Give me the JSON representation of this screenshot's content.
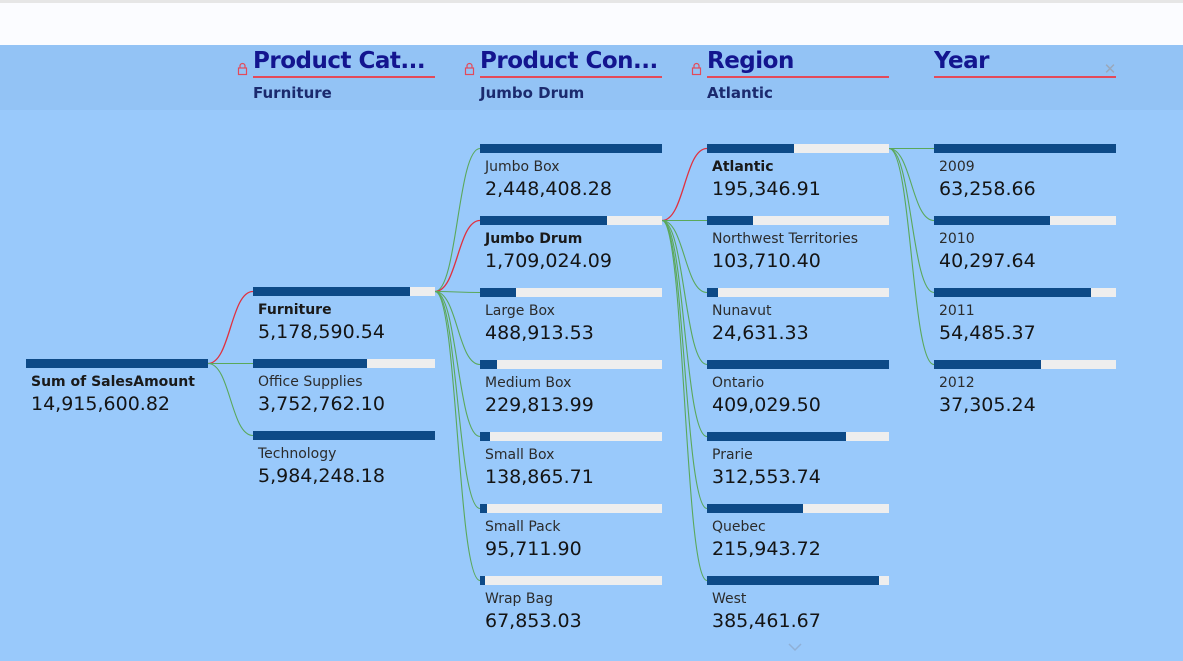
{
  "chart_data": {
    "type": "decomposition-tree",
    "root": {
      "label": "Sum of SalesAmount",
      "value": 14915600.82,
      "display": "14,915,600.82"
    },
    "levels": [
      {
        "title": "Product Cat...",
        "selected": "Furniture",
        "locked": true,
        "nodes": [
          {
            "label": "Furniture",
            "value": 5178590.54,
            "display": "5,178,590.54",
            "selected": true
          },
          {
            "label": "Office Supplies",
            "value": 3752762.1,
            "display": "3,752,762.10",
            "selected": false
          },
          {
            "label": "Technology",
            "value": 5984248.18,
            "display": "5,984,248.18",
            "selected": false
          }
        ]
      },
      {
        "title": "Product Con...",
        "selected": "Jumbo Drum",
        "locked": true,
        "nodes": [
          {
            "label": "Jumbo Box",
            "value": 2448408.28,
            "display": "2,448,408.28",
            "selected": false
          },
          {
            "label": "Jumbo Drum",
            "value": 1709024.09,
            "display": "1,709,024.09",
            "selected": true
          },
          {
            "label": "Large Box",
            "value": 488913.53,
            "display": "488,913.53",
            "selected": false
          },
          {
            "label": "Medium Box",
            "value": 229813.99,
            "display": "229,813.99",
            "selected": false
          },
          {
            "label": "Small Box",
            "value": 138865.71,
            "display": "138,865.71",
            "selected": false
          },
          {
            "label": "Small Pack",
            "value": 95711.9,
            "display": "95,711.90",
            "selected": false
          },
          {
            "label": "Wrap Bag",
            "value": 67853.03,
            "display": "67,853.03",
            "selected": false
          }
        ]
      },
      {
        "title": "Region",
        "selected": "Atlantic",
        "locked": true,
        "nodes": [
          {
            "label": "Atlantic",
            "value": 195346.91,
            "display": "195,346.91",
            "selected": true
          },
          {
            "label": "Northwest Territories",
            "value": 103710.4,
            "display": "103,710.40",
            "selected": false
          },
          {
            "label": "Nunavut",
            "value": 24631.33,
            "display": "24,631.33",
            "selected": false
          },
          {
            "label": "Ontario",
            "value": 409029.5,
            "display": "409,029.50",
            "selected": false
          },
          {
            "label": "Prarie",
            "value": 312553.74,
            "display": "312,553.74",
            "selected": false
          },
          {
            "label": "Quebec",
            "value": 215943.72,
            "display": "215,943.72",
            "selected": false
          },
          {
            "label": "West",
            "value": 385461.67,
            "display": "385,461.67",
            "selected": false
          }
        ]
      },
      {
        "title": "Year",
        "selected": "",
        "locked": false,
        "nodes": [
          {
            "label": "2009",
            "value": 63258.66,
            "display": "63,258.66",
            "selected": false
          },
          {
            "label": "2010",
            "value": 40297.64,
            "display": "40,297.64",
            "selected": false
          },
          {
            "label": "2011",
            "value": 54485.37,
            "display": "54,485.37",
            "selected": false
          },
          {
            "label": "2012",
            "value": 37305.24,
            "display": "37,305.24",
            "selected": false
          }
        ]
      }
    ]
  },
  "colors": {
    "background": "#99c9fb",
    "bar_fill": "#0d4a87",
    "bar_track": "#eeeeee",
    "link_selected": "#e0313f",
    "link_default": "#5aa85a",
    "header_title": "#13158f",
    "header_underline": "#e34a5a",
    "lock": "#e34a5a"
  },
  "icons": {
    "lock": "lock-icon",
    "close": "close-icon",
    "scroll": "chevron-down-icon"
  }
}
